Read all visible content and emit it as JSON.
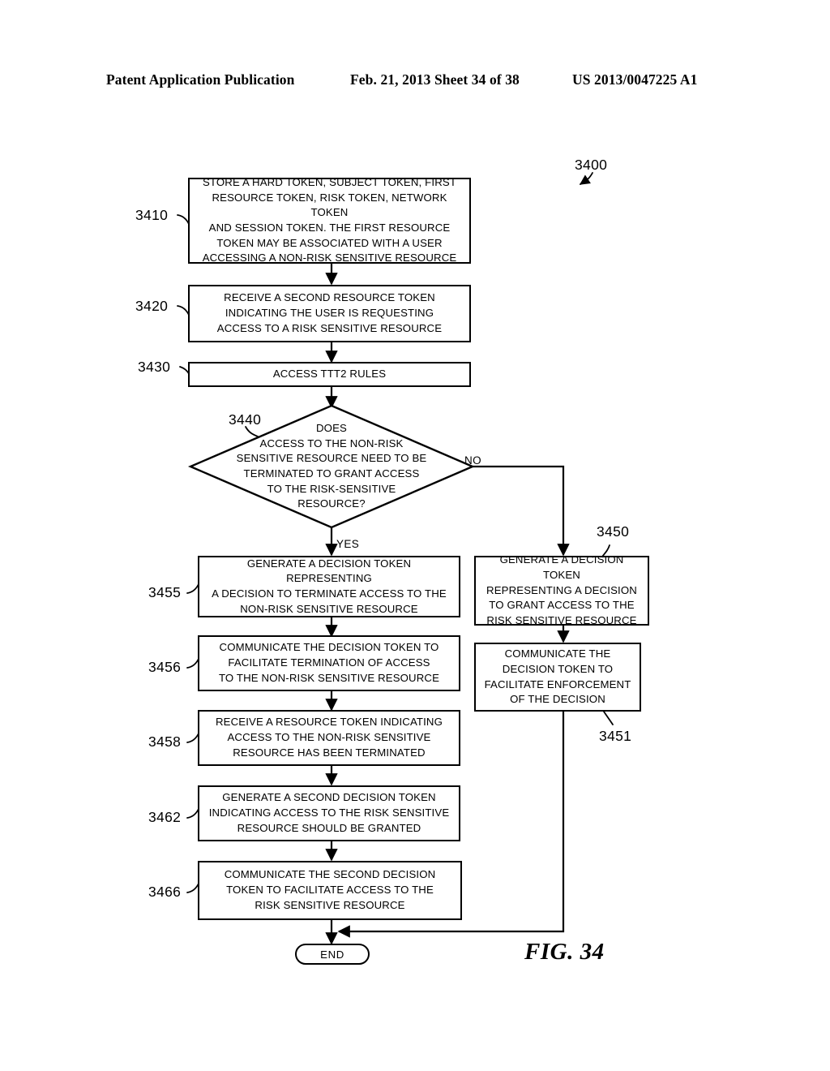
{
  "header": {
    "publication": "Patent Application Publication",
    "date_sheet": "Feb. 21, 2013  Sheet 34 of 38",
    "patent_number": "US 2013/0047225 A1"
  },
  "figure": {
    "caption": "FIG. 34",
    "diagram_ref": "3400"
  },
  "refs": {
    "r3410": "3410",
    "r3420": "3420",
    "r3430": "3430",
    "r3440": "3440",
    "r3450": "3450",
    "r3451": "3451",
    "r3455": "3455",
    "r3456": "3456",
    "r3458": "3458",
    "r3462": "3462",
    "r3466": "3466"
  },
  "nodes": {
    "store_tokens": "STORE A HARD TOKEN, SUBJECT TOKEN, FIRST\nRESOURCE TOKEN, RISK TOKEN, NETWORK TOKEN\nAND SESSION TOKEN. THE FIRST RESOURCE\nTOKEN MAY BE ASSOCIATED WITH A USER\nACCESSING A NON-RISK SENSITIVE RESOURCE",
    "receive_second_resource_token": "RECEIVE A SECOND RESOURCE TOKEN\nINDICATING THE USER IS REQUESTING\nACCESS TO A RISK SENSITIVE RESOURCE",
    "access_rules": "ACCESS TTT2 RULES",
    "decision": "DOES\nACCESS TO THE NON-RISK\nSENSITIVE RESOURCE NEED TO BE\nTERMINATED TO GRANT ACCESS\nTO THE RISK-SENSITIVE\nRESOURCE?",
    "generate_terminate_token": "GENERATE A DECISION TOKEN REPRESENTING\nA DECISION TO TERMINATE ACCESS TO THE\nNON-RISK SENSITIVE RESOURCE",
    "communicate_terminate_token": "COMMUNICATE THE DECISION TOKEN TO\nFACILITATE TERMINATION OF ACCESS\nTO THE NON-RISK SENSITIVE RESOURCE",
    "receive_terminated_token": "RECEIVE A RESOURCE TOKEN INDICATING\nACCESS TO THE NON-RISK SENSITIVE\nRESOURCE HAS BEEN TERMINATED",
    "generate_second_decision_token": "GENERATE A SECOND DECISION TOKEN\nINDICATING ACCESS TO THE RISK SENSITIVE\nRESOURCE SHOULD BE GRANTED",
    "communicate_second_decision_token": "COMMUNICATE THE SECOND DECISION\nTOKEN TO FACILITATE ACCESS TO THE\nRISK SENSITIVE RESOURCE",
    "generate_grant_token": "GENERATE A DECISION TOKEN\nREPRESENTING A DECISION\nTO GRANT ACCESS TO THE\nRISK SENSITIVE RESOURCE",
    "communicate_enforcement": "COMMUNICATE THE\nDECISION TOKEN TO\nFACILITATE ENFORCEMENT\nOF THE DECISION",
    "end": "END"
  },
  "branches": {
    "yes": "YES",
    "no": "NO"
  },
  "colors": {
    "ink": "#000000",
    "paper": "#ffffff"
  }
}
